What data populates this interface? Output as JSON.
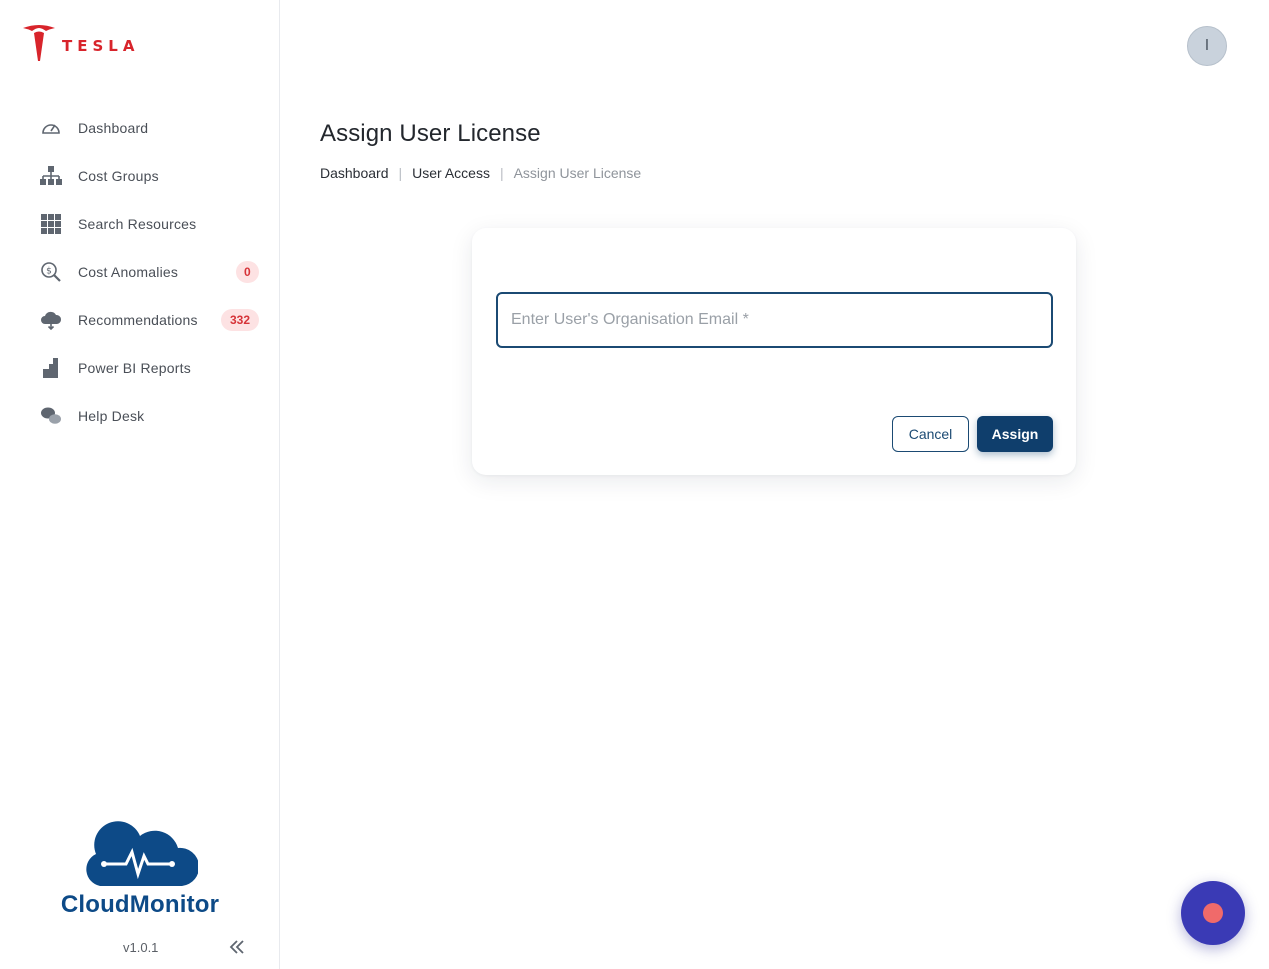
{
  "brand": {
    "name": "TESLA",
    "accent": "#d8242b"
  },
  "sidebar": {
    "items": [
      {
        "label": "Dashboard",
        "icon": "speedometer-icon"
      },
      {
        "label": "Cost Groups",
        "icon": "hierarchy-icon"
      },
      {
        "label": "Search Resources",
        "icon": "grid-icon"
      },
      {
        "label": "Cost Anomalies",
        "icon": "dollar-search-icon",
        "badge": "0"
      },
      {
        "label": "Recommendations",
        "icon": "cloud-download-icon",
        "badge": "332"
      },
      {
        "label": "Power BI Reports",
        "icon": "bar-chart-icon"
      },
      {
        "label": "Help Desk",
        "icon": "chat-bubbles-icon"
      }
    ],
    "logo_name": "CloudMonitor",
    "version": "v1.0.1"
  },
  "header": {
    "avatar_initial": "I"
  },
  "main": {
    "title": "Assign User License",
    "breadcrumb": [
      "Dashboard",
      "User Access",
      "Assign User License"
    ]
  },
  "form": {
    "email_placeholder": "Enter User's Organisation Email *",
    "email_value": "",
    "cancel_label": "Cancel",
    "assign_label": "Assign"
  },
  "colors": {
    "primary": "#0f3e6c",
    "badge_bg": "#fde2e3",
    "badge_text": "#d63338",
    "fab": "#3a3ab5",
    "fab_dot": "#f06a6a"
  }
}
